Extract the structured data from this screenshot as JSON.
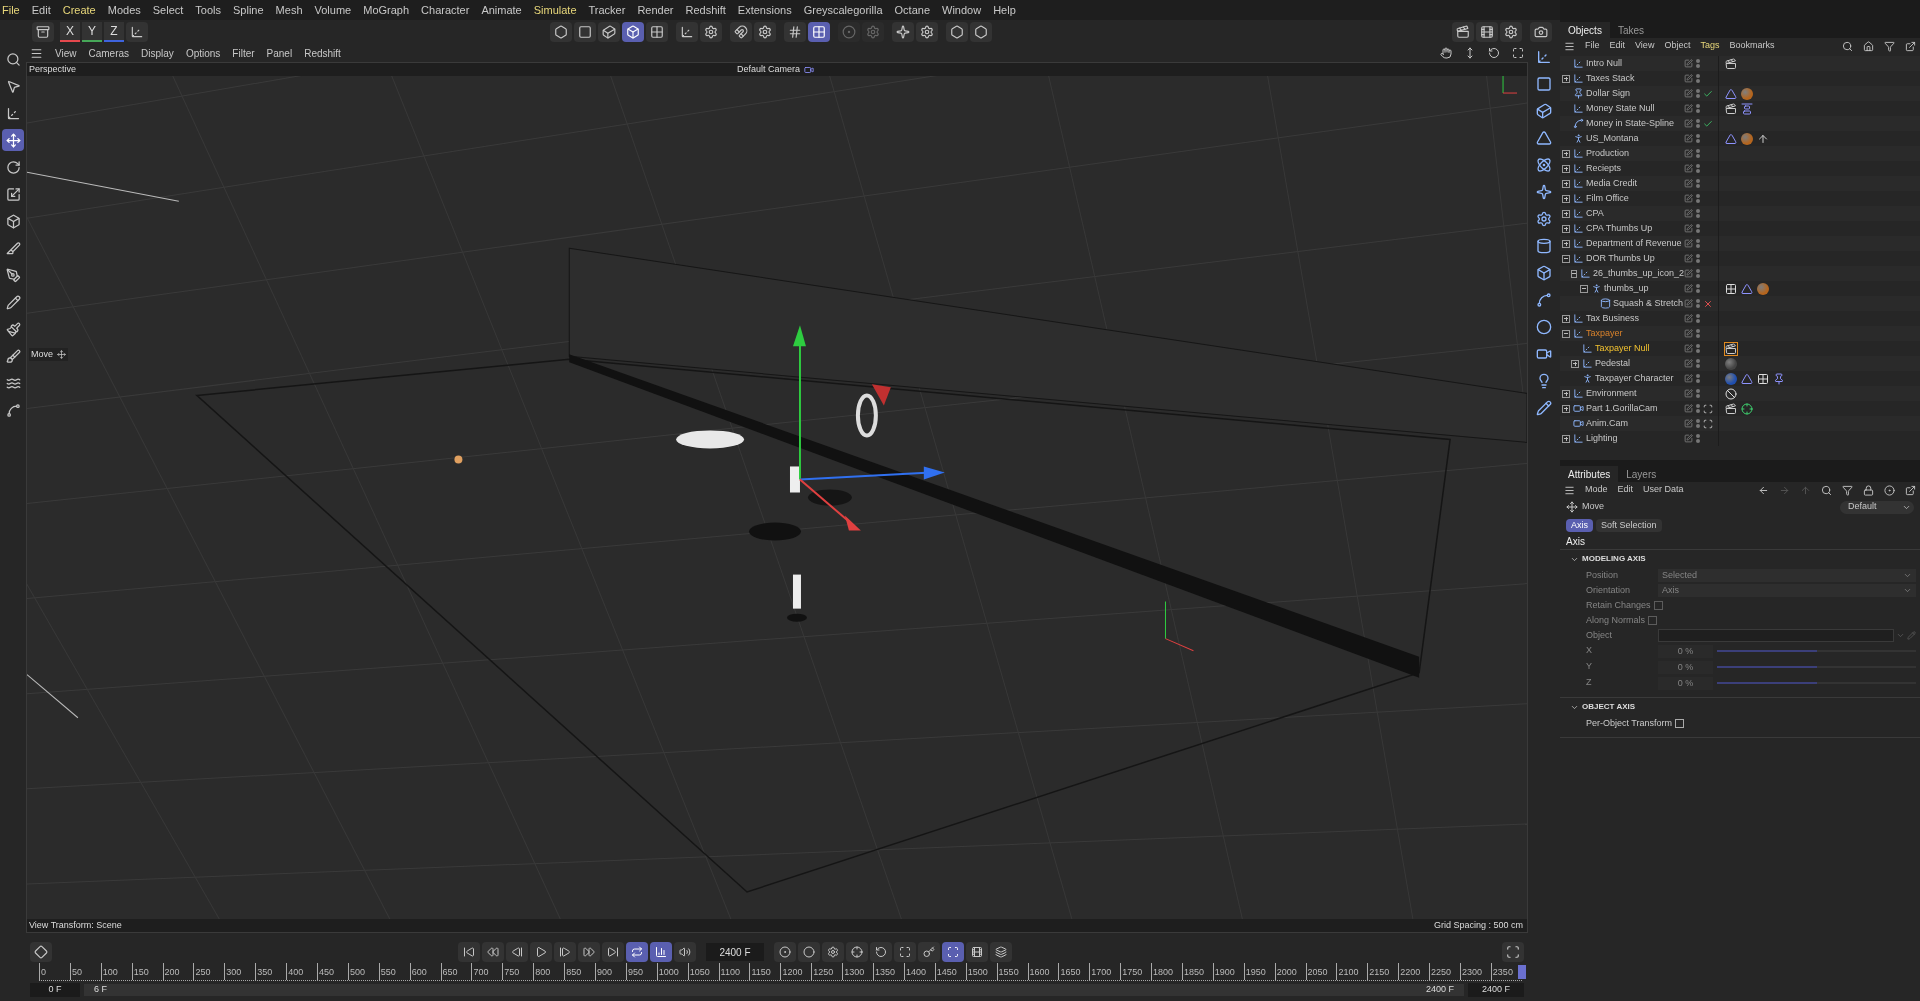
{
  "menu": [
    {
      "label": "File",
      "highlighted": true
    },
    {
      "label": "Edit",
      "highlighted": false
    },
    {
      "label": "Create",
      "highlighted": true
    },
    {
      "label": "Modes",
      "highlighted": false
    },
    {
      "label": "Select",
      "highlighted": false
    },
    {
      "label": "Tools",
      "highlighted": false
    },
    {
      "label": "Spline",
      "highlighted": false
    },
    {
      "label": "Mesh",
      "highlighted": false
    },
    {
      "label": "Volume",
      "highlighted": false
    },
    {
      "label": "MoGraph",
      "highlighted": false
    },
    {
      "label": "Character",
      "highlighted": false
    },
    {
      "label": "Animate",
      "highlighted": false
    },
    {
      "label": "Simulate",
      "highlighted": true
    },
    {
      "label": "Tracker",
      "highlighted": false
    },
    {
      "label": "Render",
      "highlighted": false
    },
    {
      "label": "Redshift",
      "highlighted": false
    },
    {
      "label": "Extensions",
      "highlighted": false
    },
    {
      "label": "Greyscalegorilla",
      "highlighted": false
    },
    {
      "label": "Octane",
      "highlighted": false
    },
    {
      "label": "Window",
      "highlighted": false
    },
    {
      "label": "Help",
      "highlighted": false
    }
  ],
  "toolbar": {
    "axes": [
      {
        "label": "X",
        "color": "#e5484d"
      },
      {
        "label": "Y",
        "color": "#46a758"
      },
      {
        "label": "Z",
        "color": "#3e63dd"
      }
    ],
    "modes": [
      {
        "kind": "points",
        "selected": false
      },
      {
        "kind": "edges",
        "selected": false
      },
      {
        "kind": "polygons",
        "selected": false
      },
      {
        "kind": "model",
        "selected": true
      },
      {
        "kind": "uv",
        "selected": false
      }
    ],
    "snap": [
      {
        "kind": "grid",
        "selected": false
      },
      {
        "kind": "snap",
        "selected": true
      }
    ]
  },
  "tools": [
    {
      "kind": "search",
      "selected": false
    },
    {
      "kind": "select",
      "selected": false
    },
    {
      "kind": "transform",
      "selected": false
    },
    {
      "kind": "move",
      "selected": true
    },
    {
      "kind": "rotate",
      "selected": false
    },
    {
      "kind": "scale",
      "selected": false
    },
    {
      "kind": "extrude",
      "selected": false
    },
    {
      "kind": "knife",
      "selected": false
    },
    {
      "kind": "pen",
      "selected": false
    },
    {
      "kind": "sketch",
      "selected": false
    },
    {
      "kind": "paint",
      "selected": false
    },
    {
      "kind": "brush",
      "selected": false
    },
    {
      "kind": "smooth",
      "selected": false
    },
    {
      "kind": "spline",
      "selected": false
    }
  ],
  "viewport": {
    "menu": [
      "View",
      "Cameras",
      "Display",
      "Options",
      "Filter",
      "Panel",
      "Redshift"
    ],
    "view_name": "Perspective",
    "camera": "Default Camera",
    "tooltip": "Move",
    "view_transform": "View Transform: Scene",
    "grid_spacing": "Grid Spacing : 500 cm"
  },
  "objects": {
    "tabs": [
      {
        "label": "Objects",
        "selected": true
      },
      {
        "label": "Takes",
        "selected": false
      }
    ],
    "menu": [
      {
        "label": "File",
        "highlighted": false
      },
      {
        "label": "Edit",
        "highlighted": false
      },
      {
        "label": "View",
        "highlighted": false
      },
      {
        "label": "Object",
        "highlighted": false
      },
      {
        "label": "Tags",
        "highlighted": true
      },
      {
        "label": "Bookmarks",
        "highlighted": false
      }
    ],
    "tree": [
      {
        "name": "Intro Null",
        "kind": "null",
        "selected": false,
        "tags": [
          {
            "kind": "scene"
          }
        ]
      },
      {
        "name": "Taxes Stack",
        "kind": "null",
        "selected": false,
        "expanded": false
      },
      {
        "name": "Dollar Sign",
        "kind": "object",
        "selected": false,
        "enabled": true,
        "tags": [
          {
            "kind": "phong"
          },
          {
            "kind": "material-orange"
          }
        ]
      },
      {
        "name": "Money State Null",
        "kind": "null",
        "selected": false,
        "tags": [
          {
            "kind": "scene"
          },
          {
            "kind": "vibrate"
          }
        ]
      },
      {
        "name": "Money in State-Spline",
        "kind": "spline",
        "selected": false,
        "enabled": true
      },
      {
        "name": "US_Montana",
        "kind": "figure",
        "selected": false,
        "tags": [
          {
            "kind": "phong"
          },
          {
            "kind": "material-orange"
          },
          {
            "kind": "align"
          }
        ]
      },
      {
        "name": "Production",
        "kind": "null",
        "selected": false,
        "expanded": false
      },
      {
        "name": "Reciepts",
        "kind": "null",
        "selected": false,
        "expanded": false
      },
      {
        "name": "Media Credit",
        "kind": "null",
        "selected": false,
        "expanded": false
      },
      {
        "name": "Film Office",
        "kind": "null",
        "selected": false,
        "expanded": false
      },
      {
        "name": "CPA",
        "kind": "null",
        "selected": false,
        "expanded": false
      },
      {
        "name": "CPA Thumbs Up",
        "kind": "null",
        "selected": false,
        "expanded": false
      },
      {
        "name": "Department of Revenue",
        "kind": "null",
        "selected": false,
        "expanded": false
      },
      {
        "name": "DOR Thumbs Up",
        "kind": "null",
        "selected": false,
        "expanded": true,
        "children": [
          {
            "name": "26_thumbs_up_icon_2",
            "kind": "null",
            "selected": false,
            "expanded": true,
            "children": [
              {
                "name": "thumbs_up",
                "kind": "figure",
                "selected": false,
                "expanded": true,
                "tags": [
                  {
                    "kind": "checker"
                  },
                  {
                    "kind": "phong"
                  },
                  {
                    "kind": "material-orange"
                  }
                ],
                "children": [
                  {
                    "name": "Squash & Stretch",
                    "kind": "deformer",
                    "selected": false,
                    "enabled": false
                  }
                ]
              }
            ]
          }
        ]
      },
      {
        "name": "Tax Business",
        "kind": "null",
        "selected": false,
        "expanded": false
      },
      {
        "name": "Taxpayer",
        "kind": "null",
        "selected": false,
        "highlighted": true,
        "expanded": true,
        "children": [
          {
            "name": "Taxpayer Null",
            "kind": "null",
            "selected": true,
            "tags": [
              {
                "kind": "scene-active"
              }
            ]
          },
          {
            "name": "Pedestal",
            "kind": "null",
            "selected": false,
            "expanded": false,
            "tags": [
              {
                "kind": "material-grey"
              }
            ]
          },
          {
            "name": "Taxpayer Character",
            "kind": "figure",
            "selected": false,
            "tags": [
              {
                "kind": "material-blue"
              },
              {
                "kind": "phong"
              },
              {
                "kind": "checker"
              },
              {
                "kind": "pin"
              }
            ]
          }
        ]
      },
      {
        "name": "Environment",
        "kind": "null",
        "selected": false,
        "expanded": false,
        "tags": [
          {
            "kind": "no"
          }
        ]
      },
      {
        "name": "Part 1.GorillaCam",
        "kind": "camera",
        "selected": false,
        "expanded": false,
        "tags": [
          {
            "kind": "scene"
          },
          {
            "kind": "target"
          }
        ]
      },
      {
        "name": "Anim.Cam",
        "kind": "camera",
        "selected": false
      },
      {
        "name": "Lighting",
        "kind": "null",
        "selected": false,
        "expanded": false
      }
    ]
  },
  "attributes": {
    "tabs": [
      {
        "label": "Attributes",
        "selected": true
      },
      {
        "label": "Layers",
        "selected": false
      }
    ],
    "menu": [
      "Mode",
      "Edit",
      "User Data"
    ],
    "tool": "Move",
    "preset": "Default",
    "subtabs": [
      {
        "label": "Axis",
        "selected": true
      },
      {
        "label": "Soft Selection",
        "selected": false
      }
    ],
    "heading": "Axis",
    "sections": [
      {
        "title": "MODELING AXIS",
        "expanded": true,
        "fields": [
          {
            "kind": "dropdown",
            "label": "Position",
            "value": "Selected",
            "disabled": true
          },
          {
            "kind": "dropdown",
            "label": "Orientation",
            "value": "Axis",
            "disabled": true
          },
          {
            "kind": "checkbox",
            "label": "Retain Changes",
            "checked": false,
            "disabled": true
          },
          {
            "kind": "checkbox",
            "label": "Along Normals",
            "checked": false,
            "disabled": true
          },
          {
            "kind": "link",
            "label": "Object",
            "disabled": true
          },
          {
            "kind": "slider",
            "label": "X",
            "value": "0 %",
            "level": 0.5,
            "disabled": true
          },
          {
            "kind": "slider",
            "label": "Y",
            "value": "0 %",
            "level": 0.5,
            "disabled": true
          },
          {
            "kind": "slider",
            "label": "Z",
            "value": "0 %",
            "level": 0.5,
            "disabled": true
          }
        ]
      },
      {
        "title": "OBJECT AXIS",
        "expanded": true,
        "fields": [
          {
            "kind": "checkbox",
            "label": "Per-Object Transform",
            "checked": false,
            "disabled": false
          }
        ]
      }
    ]
  },
  "timeline": {
    "transport": [
      {
        "kind": "first",
        "selected": false
      },
      {
        "kind": "prev-key",
        "selected": false
      },
      {
        "kind": "prev-frame",
        "selected": false
      },
      {
        "kind": "play",
        "selected": false
      },
      {
        "kind": "next-frame",
        "selected": false
      },
      {
        "kind": "next-key",
        "selected": false
      },
      {
        "kind": "last",
        "selected": false
      },
      {
        "kind": "loop",
        "selected": true
      },
      {
        "kind": "mode",
        "selected": true
      },
      {
        "kind": "sound",
        "selected": false
      }
    ],
    "frame": "2400 F",
    "keys": [
      {
        "kind": "record",
        "selected": false
      },
      {
        "kind": "autokey",
        "selected": false
      },
      {
        "kind": "settings",
        "selected": false
      },
      {
        "kind": "key-pos",
        "selected": false
      },
      {
        "kind": "key-rot",
        "selected": false
      },
      {
        "kind": "key-scale",
        "selected": false
      },
      {
        "kind": "key-param",
        "selected": false
      },
      {
        "kind": "key-pla",
        "selected": true
      },
      {
        "kind": "clip",
        "selected": false
      },
      {
        "kind": "clip2",
        "selected": false
      }
    ],
    "ruler": [
      "0",
      "50",
      "100",
      "150",
      "200",
      "250",
      "300",
      "350",
      "400",
      "450",
      "500",
      "550",
      "600",
      "650",
      "700",
      "750",
      "800",
      "850",
      "900",
      "950",
      "1000",
      "1050",
      "1100",
      "1150",
      "1200",
      "1250",
      "1300",
      "1350",
      "1400",
      "1450",
      "1500",
      "1550",
      "1600",
      "1650",
      "1700",
      "1750",
      "1800",
      "1850",
      "1900",
      "1950",
      "2000",
      "2050",
      "2100",
      "2150",
      "2200",
      "2250",
      "2300",
      "2350"
    ],
    "playhead": {
      "level": 1
    },
    "start": "0 F",
    "preview_start": "6 F",
    "preview_end": "2400 F",
    "end": "2400 F"
  }
}
